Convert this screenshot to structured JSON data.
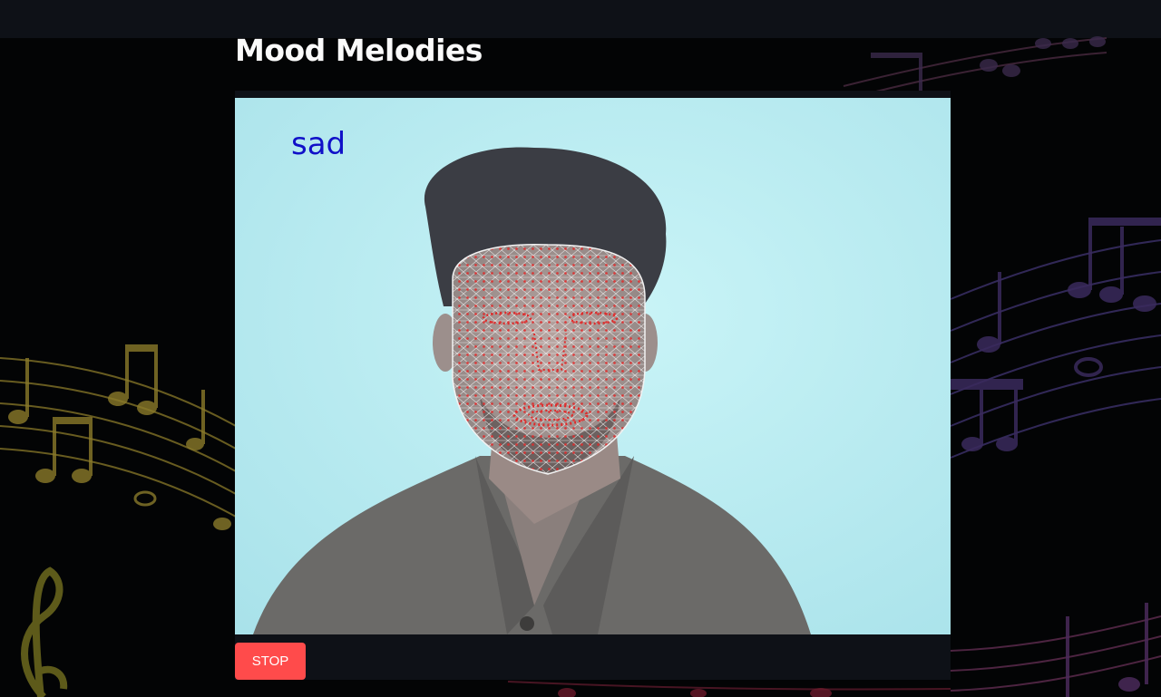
{
  "app": {
    "title": "Mood Melodies"
  },
  "video": {
    "emotion_label": "sad",
    "emotion_label_color": "#1010c8",
    "background_color": "#bfeef2",
    "mesh_color": "#f0f0f0",
    "landmark_color": "#e02a2a"
  },
  "controls": {
    "stop_label": "STOP",
    "stop_color": "#ff4b4b"
  },
  "theme": {
    "page_background": "#030405",
    "header_background": "#0e1117",
    "panel_background": "#0e1117",
    "title_color": "#fafafa"
  },
  "icons": [
    "music-notes-decoration-icon",
    "treble-clef-icon"
  ]
}
